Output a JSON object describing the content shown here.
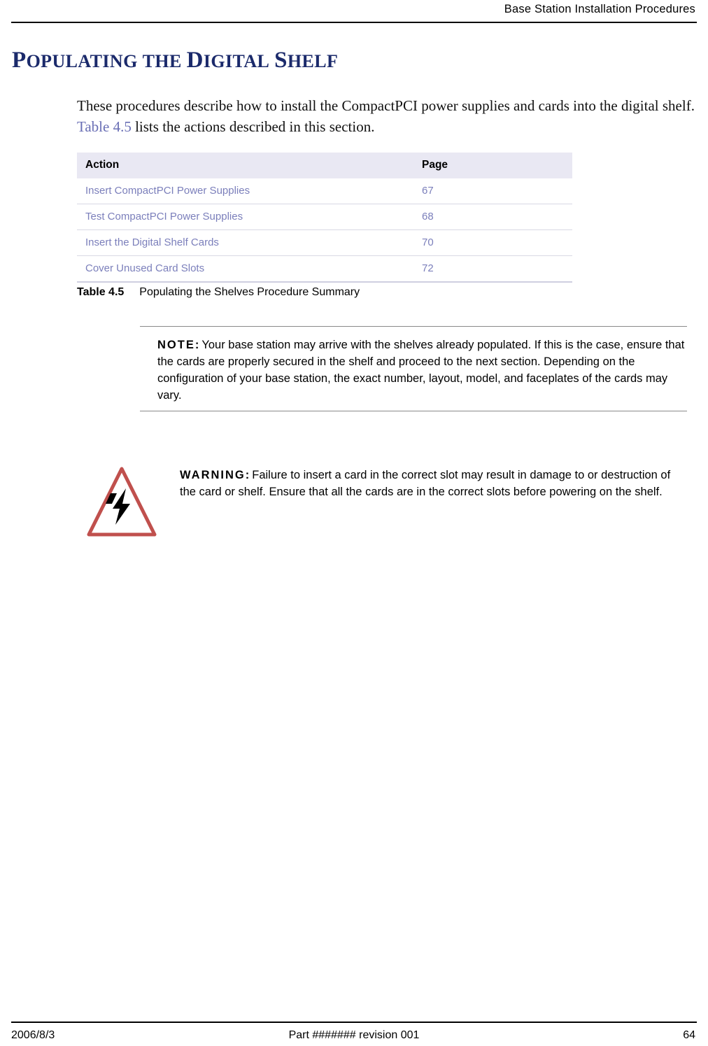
{
  "header": {
    "title": "Base Station Installation Procedures"
  },
  "section": {
    "heading_parts": [
      {
        "text": "P",
        "size": "cap"
      },
      {
        "text": "OPULATING",
        "size": "small"
      },
      {
        "text": " ",
        "size": "small"
      },
      {
        "text": "THE",
        "size": "small"
      },
      {
        "text": " ",
        "size": "small"
      },
      {
        "text": "D",
        "size": "cap"
      },
      {
        "text": "IGITAL",
        "size": "small"
      },
      {
        "text": " ",
        "size": "small"
      },
      {
        "text": "S",
        "size": "cap"
      },
      {
        "text": "HELF",
        "size": "small"
      }
    ],
    "heading_plain": "POPULATING THE DIGITAL SHELF"
  },
  "intro": {
    "before_xref": "These procedures describe how to install the CompactPCI power supplies and cards into the digital shelf. ",
    "xref": "Table 4.5",
    "after_xref": " lists the actions described in this section."
  },
  "summary_table": {
    "columns": [
      "Action",
      "Page"
    ],
    "rows": [
      {
        "action": "Insert CompactPCI Power Supplies",
        "page": "67"
      },
      {
        "action": "Test CompactPCI Power Supplies",
        "page": "68"
      },
      {
        "action": "Insert the Digital Shelf Cards",
        "page": "70"
      },
      {
        "action": "Cover Unused Card Slots",
        "page": "72"
      }
    ],
    "caption_label": "Table 4.5",
    "caption_text": "Populating the Shelves Procedure Summary"
  },
  "note": {
    "label": "NOTE:",
    "text": "Your base station may arrive with the shelves already populated. If this is the case, ensure that the cards are properly secured in the shelf and proceed to the next section. Depending on the configuration of your base station, the exact number, layout, model, and faceplates of the cards may vary."
  },
  "warning": {
    "label": "WARNING:",
    "text": "Failure to insert a card in the correct slot may result in damage to or destruction of the card or shelf. Ensure that all the cards are in the correct slots before powering on the shelf.",
    "icon": "electrical-hazard-icon",
    "icon_border_color": "#c0504d",
    "icon_bolt_color": "#000000"
  },
  "footer": {
    "date": "2006/8/3",
    "center": "Part ####### revision 001",
    "page_number": "64"
  },
  "colors": {
    "heading": "#1b2a6b",
    "link": "#7b7fbb",
    "table_header_bg": "#e9e8f3"
  }
}
